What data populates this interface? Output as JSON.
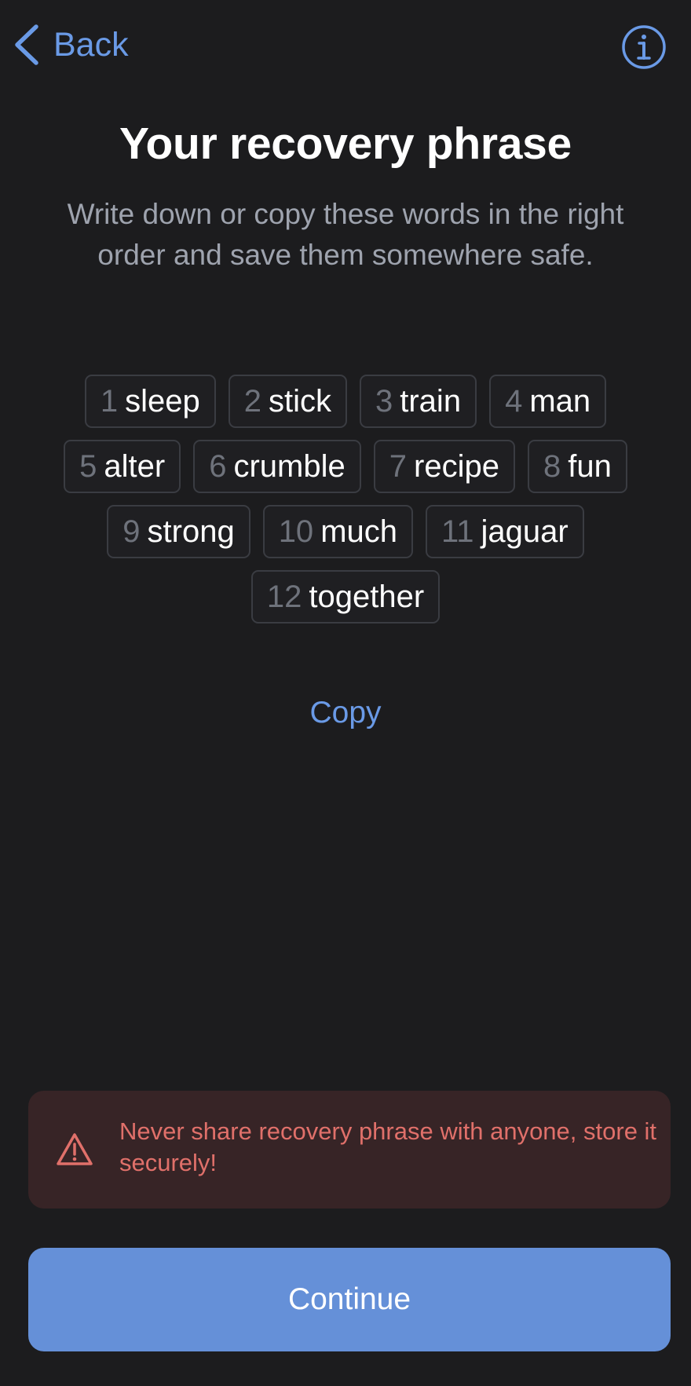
{
  "nav": {
    "back_label": "Back",
    "back_icon": "chevron-left-icon",
    "info_icon": "info-icon"
  },
  "title": "Your recovery phrase",
  "subtitle": "Write down or copy these words in the right order and save them somewhere safe.",
  "words": [
    {
      "num": "1",
      "word": "sleep"
    },
    {
      "num": "2",
      "word": "stick"
    },
    {
      "num": "3",
      "word": "train"
    },
    {
      "num": "4",
      "word": "man"
    },
    {
      "num": "5",
      "word": "alter"
    },
    {
      "num": "6",
      "word": "crumble"
    },
    {
      "num": "7",
      "word": "recipe"
    },
    {
      "num": "8",
      "word": "fun"
    },
    {
      "num": "9",
      "word": "strong"
    },
    {
      "num": "10",
      "word": "much"
    },
    {
      "num": "11",
      "word": "jaguar"
    },
    {
      "num": "12",
      "word": "together"
    }
  ],
  "copy_label": "Copy",
  "warning": {
    "icon": "warning-triangle-icon",
    "text": "Never share recovery phrase with anyone, store it securely!"
  },
  "continue_label": "Continue",
  "colors": {
    "background": "#1c1c1e",
    "accent": "#6a9ae6",
    "button": "#6590d8",
    "warning_bg": "#372426",
    "warning_text": "#e0706a",
    "muted": "#9ea3ae"
  }
}
